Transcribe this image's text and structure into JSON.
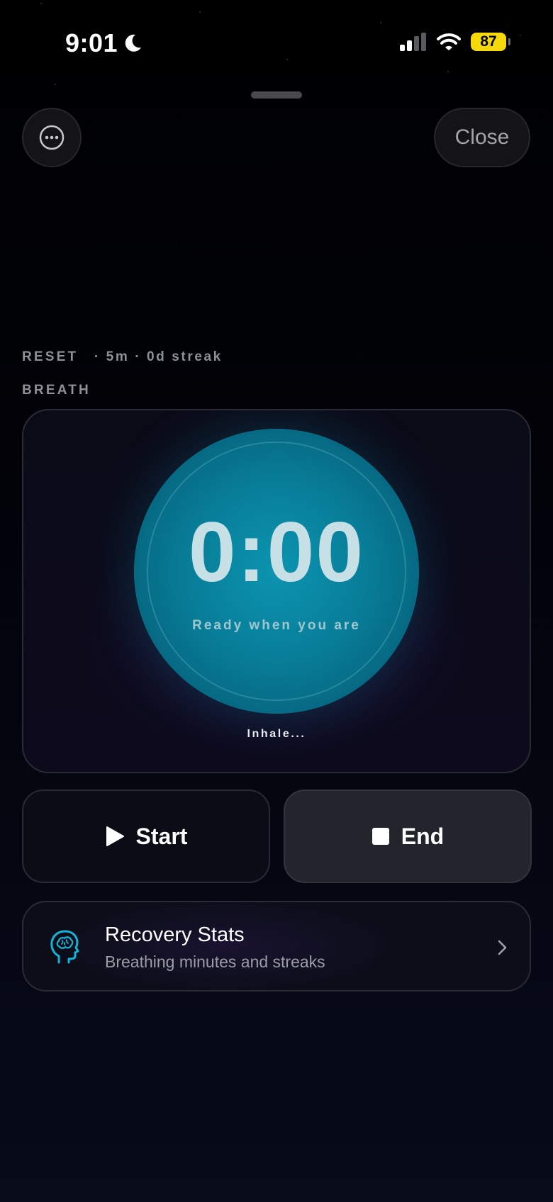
{
  "status_bar": {
    "time": "9:01",
    "battery": "87"
  },
  "header": {
    "close_label": "Close"
  },
  "session": {
    "title": "RESET",
    "meta": "· 5m · 0d streak"
  },
  "breath": {
    "label": "BREATH",
    "timer": "0:00",
    "subtitle": "Ready when you are",
    "phase": "Inhale..."
  },
  "controls": {
    "start_label": "Start",
    "end_label": "End"
  },
  "stats": {
    "title": "Recovery Stats",
    "subtitle": "Breathing minutes and streaks"
  },
  "colors": {
    "accent": "#0a8aa6",
    "battery": "#f5d90a",
    "icon": "#12b4d8"
  }
}
